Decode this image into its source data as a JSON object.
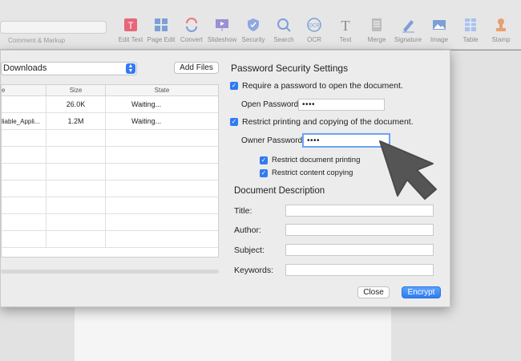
{
  "toolbar": {
    "comment_markup": "Comment & Markup",
    "items": [
      {
        "label": "Edit Text",
        "icon": "edit-text-icon"
      },
      {
        "label": "Page Edit",
        "icon": "page-edit-icon"
      },
      {
        "label": "Convert",
        "icon": "convert-icon"
      },
      {
        "label": "Slideshow",
        "icon": "slideshow-icon"
      },
      {
        "label": "Security",
        "icon": "security-icon"
      },
      {
        "label": "Search",
        "icon": "search-icon"
      },
      {
        "label": "OCR",
        "icon": "ocr-icon"
      },
      {
        "label": "Text",
        "icon": "text-icon"
      },
      {
        "label": "Merge",
        "icon": "merge-icon"
      },
      {
        "label": "Signature",
        "icon": "signature-icon"
      },
      {
        "label": "Image",
        "icon": "image-icon"
      },
      {
        "label": "Table",
        "icon": "table-icon"
      },
      {
        "label": "Stamp",
        "icon": "stamp-icon"
      }
    ]
  },
  "files": {
    "folder": "Downloads",
    "add_files": "Add Files",
    "columns": [
      "e",
      "Size",
      "State"
    ],
    "rows": [
      {
        "name": "",
        "size": "26.0K",
        "state": "Waiting..."
      },
      {
        "name": "liable_Appli...",
        "size": "1.2M",
        "state": "Waiting..."
      }
    ]
  },
  "security": {
    "title": "Password Security Settings",
    "require_open": "Require a password to open the document.",
    "open_password_label": "Open Password:",
    "open_password_value": "••••",
    "restrict": "Restrict printing and copying of the document.",
    "owner_password_label": "Owner Password:",
    "owner_password_value": "••••",
    "restrict_printing": "Restrict document printing",
    "restrict_copying": "Restrict content copying"
  },
  "description": {
    "title": "Document Description",
    "title_label": "Title:",
    "author_label": "Author:",
    "subject_label": "Subject:",
    "keywords_label": "Keywords:"
  },
  "buttons": {
    "close": "Close",
    "encrypt": "Encrypt"
  },
  "colors": {
    "accent": "#2f7bf0",
    "edit_text_icon": "#e8657a",
    "toolbar_icon": "#7d9fd6"
  }
}
